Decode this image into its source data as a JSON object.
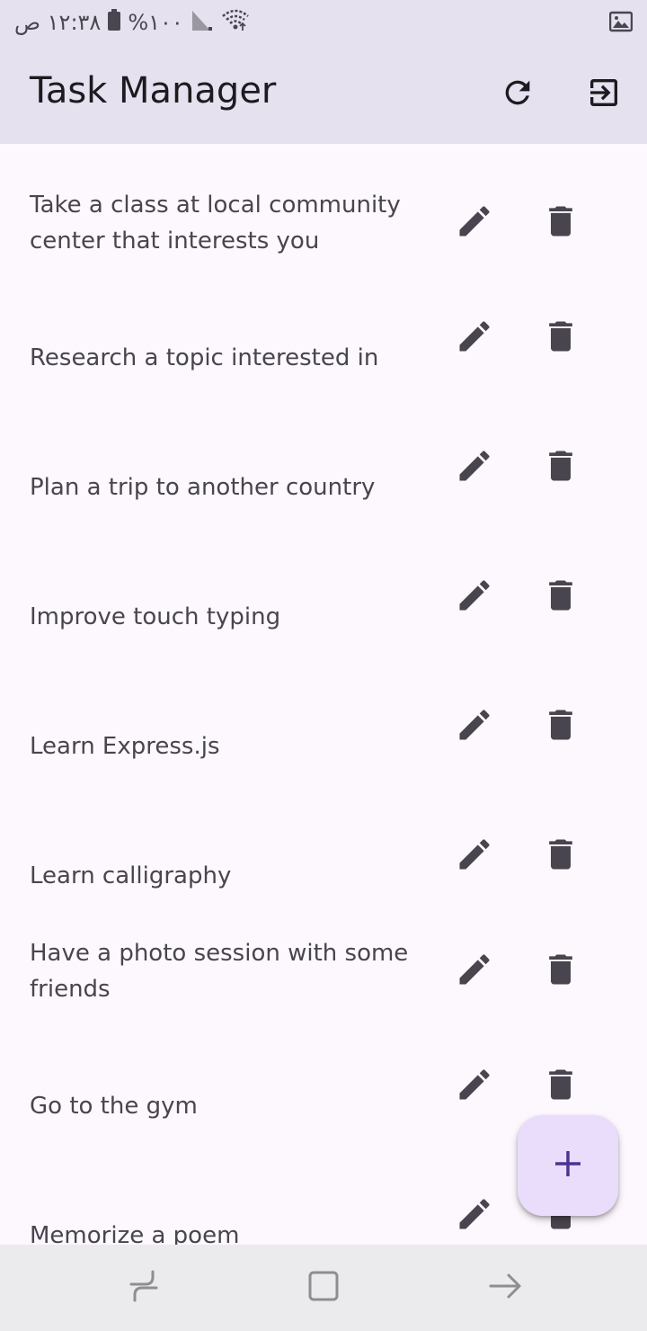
{
  "status_bar": {
    "time": "١٢:٣٨ ص",
    "battery": "%١٠٠",
    "icons": [
      "battery-icon",
      "signal-icon",
      "wifi-icon",
      "gallery-notification-icon"
    ]
  },
  "app_bar": {
    "title": "Task Manager",
    "actions": [
      "refresh-icon",
      "logout-icon"
    ]
  },
  "tasks": [
    {
      "title": "Take a class at local community center that interests you"
    },
    {
      "title": "Research a topic interested in"
    },
    {
      "title": "Plan a trip to another country"
    },
    {
      "title": "Improve touch typing"
    },
    {
      "title": "Learn Express.js"
    },
    {
      "title": "Learn calligraphy"
    },
    {
      "title": "Have a photo session with some friends"
    },
    {
      "title": "Go to the gym"
    },
    {
      "title": "Memorize a poem"
    }
  ],
  "row_actions": [
    "edit-icon",
    "delete-icon"
  ],
  "fab": {
    "icon": "add-icon"
  },
  "nav_bar": {
    "icons": [
      "recents-icon",
      "home-icon",
      "back-icon"
    ]
  },
  "colors": {
    "app_bar_bg": "#e6e1ef",
    "page_bg": "#fdf7fe",
    "icon": "#49454f",
    "fab_bg": "#e9ddfb",
    "fab_icon": "#4a3590",
    "nav_bar_bg": "#ebeaec"
  }
}
